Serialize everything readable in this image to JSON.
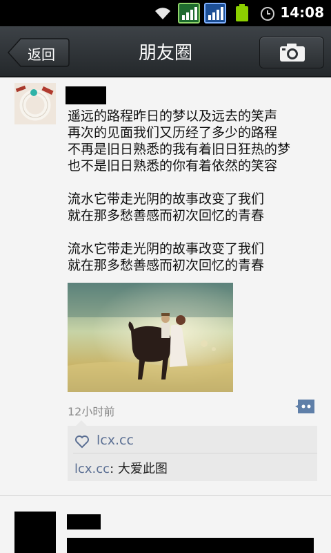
{
  "status_bar": {
    "time": "14:08",
    "icons": [
      "wifi-icon",
      "signal-icon",
      "signal-icon",
      "battery-icon",
      "alarm-icon"
    ]
  },
  "header": {
    "back_label": "返回",
    "title": "朋友圈",
    "camera_icon": "camera-icon"
  },
  "posts": [
    {
      "author": "",
      "lines": [
        "遥远的路程昨日的梦以及远去的笑声",
        "再次的见面我们又历经了多少的路程",
        "不再是旧日熟悉的我有着旧日狂热的梦",
        "也不是旧日熟悉的你有着依然的笑容",
        "",
        "流水它带走光阴的故事改变了我们",
        "就在那多愁善感而初次回忆的青春",
        "",
        "流水它带走光阴的故事改变了我们",
        "就在那多愁善感而初次回忆的青春"
      ],
      "timestamp": "12小时前",
      "likes": [
        "lcx.cc"
      ],
      "comments": [
        {
          "author": "lcx.cc",
          "separator": ": ",
          "text": "大爱此图"
        }
      ]
    },
    {
      "author": ""
    }
  ],
  "colors": {
    "titlebar": "#2f3337",
    "link": "#5b6f93",
    "background": "#f4f4f4"
  }
}
